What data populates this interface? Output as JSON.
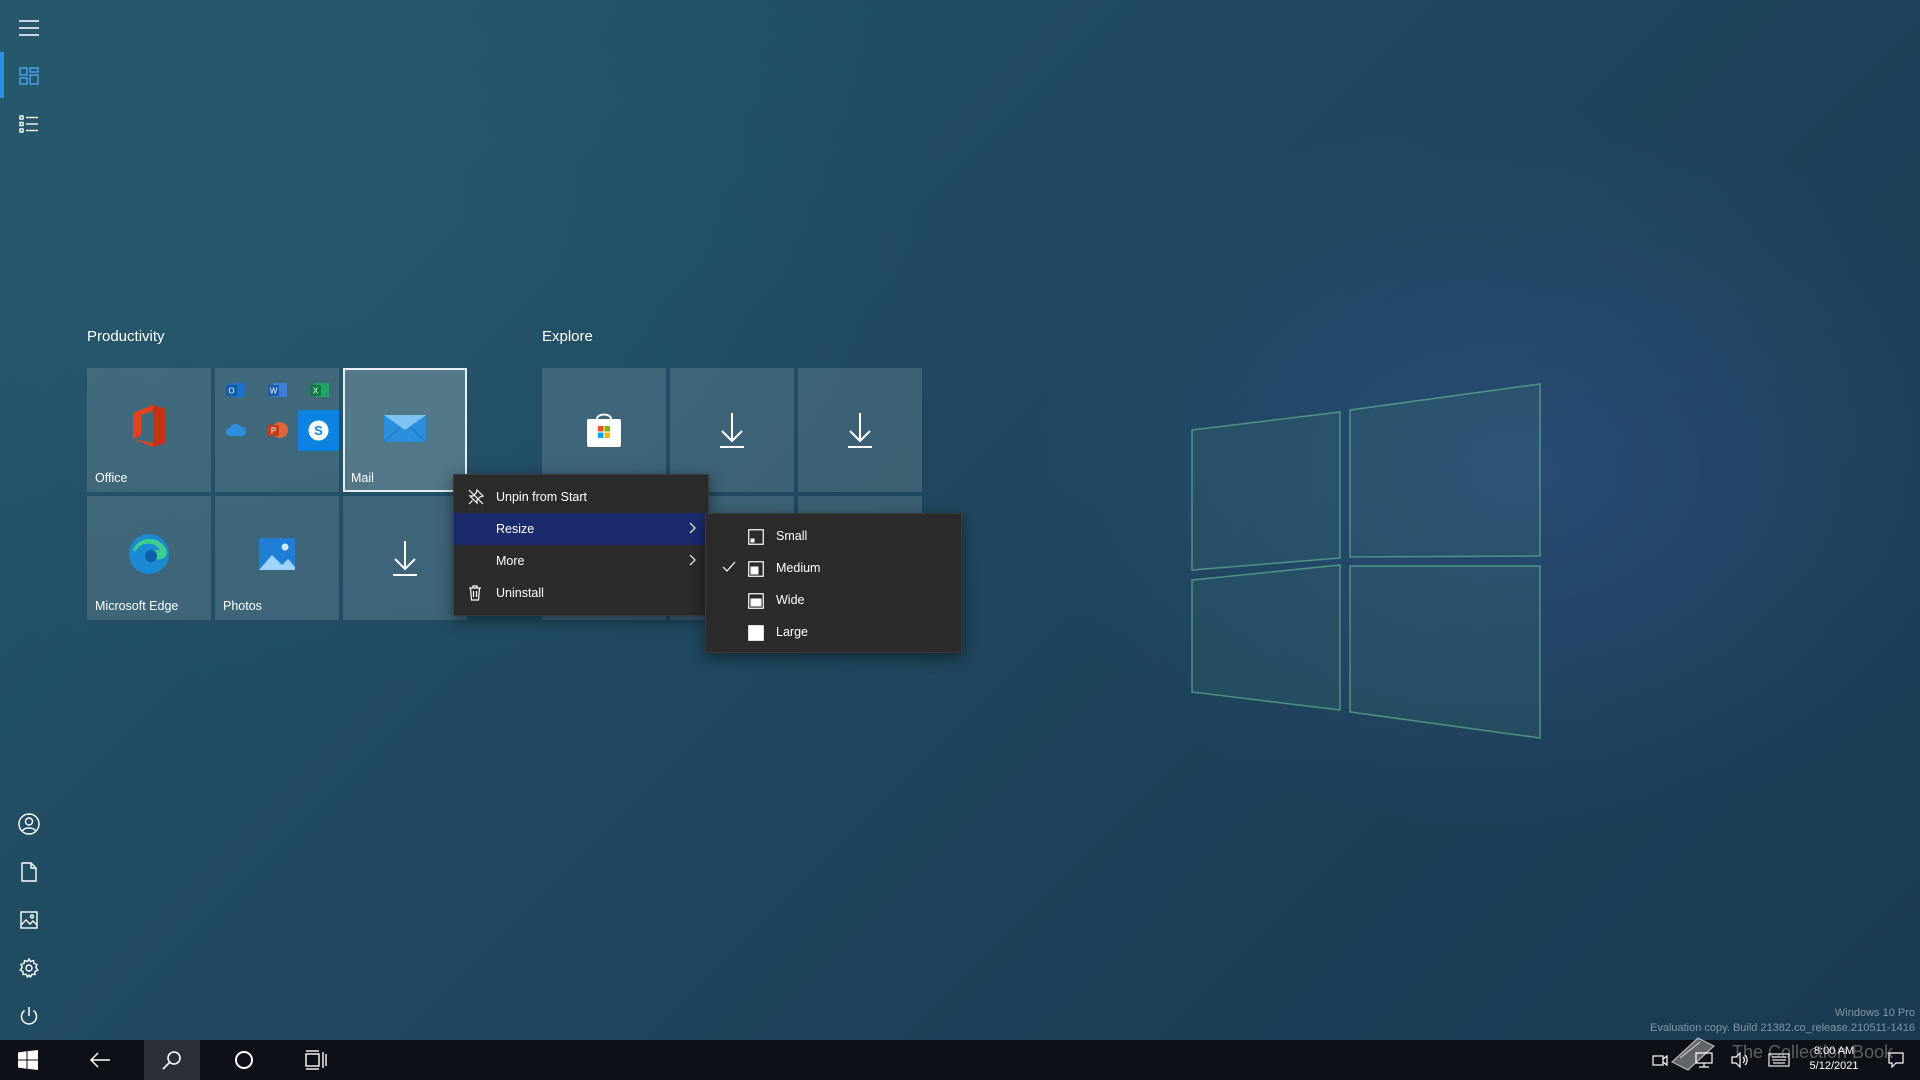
{
  "groups": [
    {
      "title": "Productivity"
    },
    {
      "title": "Explore"
    }
  ],
  "tiles": {
    "office": "Office",
    "mail": "Mail",
    "edge": "Microsoft Edge",
    "photos": "Photos"
  },
  "context_menu": {
    "items": [
      {
        "label": "Unpin from Start",
        "icon": "unpin-icon"
      },
      {
        "label": "Resize",
        "icon": "",
        "highlighted": true
      },
      {
        "label": "More",
        "icon": ""
      },
      {
        "label": "Uninstall",
        "icon": "trash-icon"
      }
    ]
  },
  "resize_menu": {
    "items": [
      {
        "label": "Small",
        "checked": false
      },
      {
        "label": "Medium",
        "checked": true
      },
      {
        "label": "Wide",
        "checked": false
      },
      {
        "label": "Large",
        "checked": false
      }
    ]
  },
  "watermark": {
    "line1": "Windows 10 Pro",
    "line2": "Evaluation copy. Build 21382.co_release.210511-1416",
    "brand": "The Collection Book"
  },
  "clock": {
    "time": "8:00 AM",
    "date": "5/12/2021"
  },
  "colors": {
    "accent": "#2b8ee8",
    "menu_bg": "#2b2b2b",
    "menu_highlight": "#1a2a6d",
    "taskbar": "#0d1117"
  }
}
